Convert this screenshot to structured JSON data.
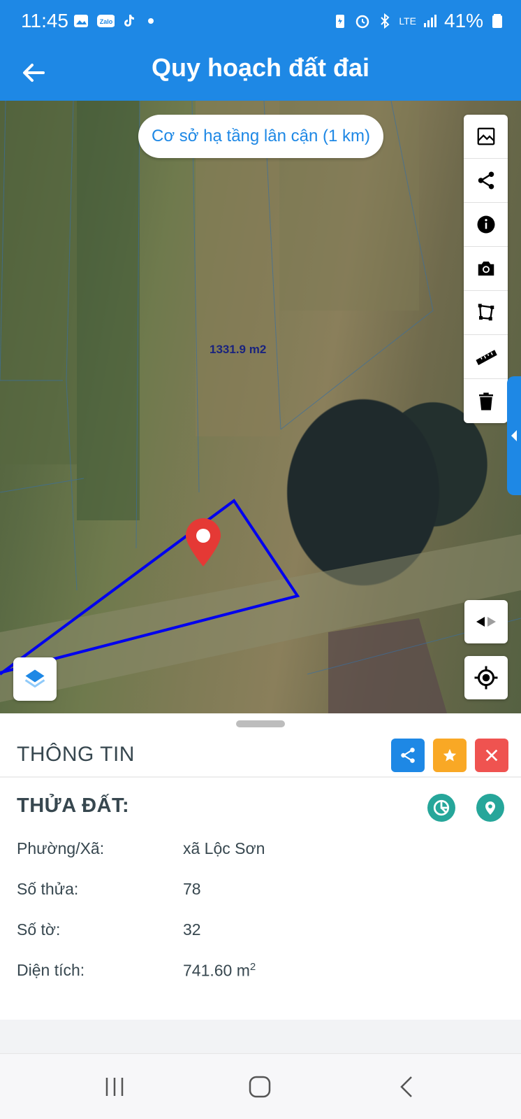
{
  "status_bar": {
    "time": "11:45",
    "battery": "41%",
    "network": "LTE",
    "left_icons": [
      "gallery-icon",
      "zalo-icon",
      "tiktok-icon",
      "dot-icon"
    ],
    "right_icons": [
      "battery-saver-icon",
      "alarm-icon",
      "bluetooth-icon",
      "lte-icon",
      "signal-icon",
      "battery-icon"
    ]
  },
  "app_bar": {
    "title": "Quy hoạch đất đai",
    "back_icon": "arrow-left-icon"
  },
  "map": {
    "nearby_button": "Cơ sở hạ tầng lân cận (1 km)",
    "area_label": "1331.9 m2",
    "parcel_outline_color": "#0000ee",
    "marker_color": "#e53935",
    "tools": [
      "image-overlay-icon",
      "share-icon",
      "info-icon",
      "camera-icon",
      "polygon-icon",
      "ruler-icon",
      "trash-icon"
    ],
    "side_tab_icon": "chevron-left-icon",
    "compare_icon": "compare-arrows-icon",
    "locate_icon": "crosshair-icon",
    "layers_icon": "layers-icon"
  },
  "sheet": {
    "title": "THÔNG TIN",
    "actions": [
      "share-icon",
      "star-icon",
      "close-icon"
    ],
    "section_title": "THỬA ĐẤT:",
    "section_icons": [
      "pie-chart-icon",
      "map-pin-icon"
    ],
    "rows": [
      {
        "label": "Phường/Xã:",
        "value": "xã Lộc Sơn"
      },
      {
        "label": "Số thửa:",
        "value": "78"
      },
      {
        "label": "Số tờ:",
        "value": "32"
      },
      {
        "label": "Diện tích:",
        "value": "741.60 m",
        "sup": "2"
      }
    ]
  },
  "nav_bar": {
    "buttons": [
      "recent-apps-icon",
      "home-icon",
      "back-icon"
    ]
  },
  "colors": {
    "primary": "#1e88e5",
    "accent_yellow": "#f9a825",
    "danger": "#ef5350",
    "teal": "#26a69a",
    "text": "#37474f"
  }
}
